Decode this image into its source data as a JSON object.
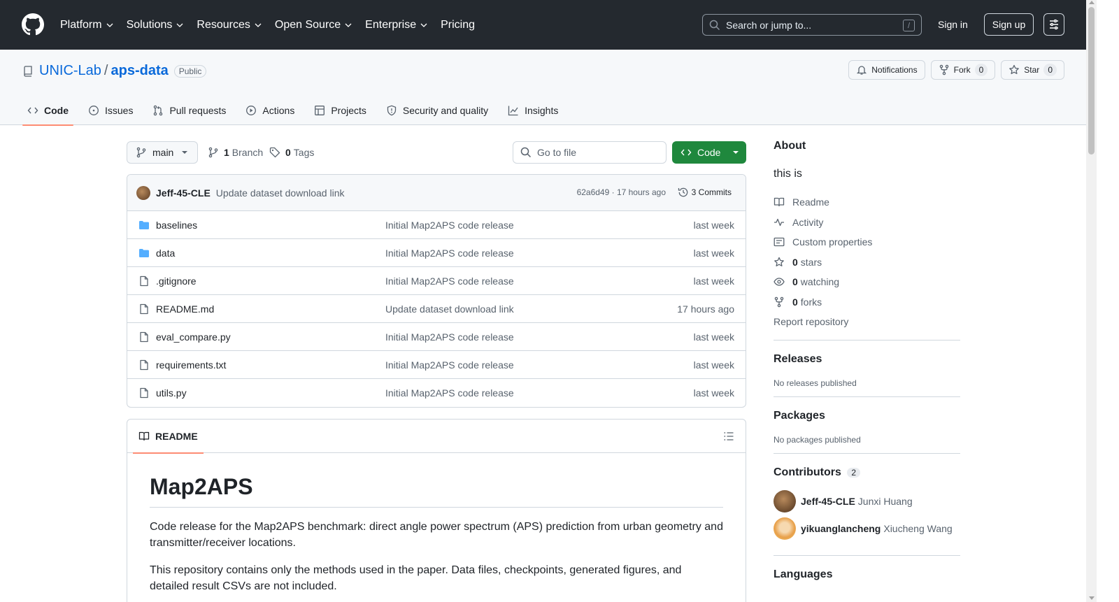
{
  "colors": {
    "header_bg": "#24292f",
    "link": "#0969da",
    "primary_button": "#1f883d",
    "tab_underline": "#fd8c73",
    "muted_text": "#59636e",
    "border": "#d0d7de"
  },
  "header": {
    "nav": [
      {
        "label": "Platform",
        "dropdown": true
      },
      {
        "label": "Solutions",
        "dropdown": true
      },
      {
        "label": "Resources",
        "dropdown": true
      },
      {
        "label": "Open Source",
        "dropdown": true
      },
      {
        "label": "Enterprise",
        "dropdown": true
      },
      {
        "label": "Pricing",
        "dropdown": false
      }
    ],
    "search_placeholder": "Search or jump to...",
    "search_shortcut": "/",
    "signin": "Sign in",
    "signup": "Sign up"
  },
  "repo": {
    "owner": "UNIC-Lab",
    "separator": "/",
    "name": "aps-data",
    "visibility": "Public",
    "notifications_label": "Notifications",
    "fork_label": "Fork",
    "fork_count": "0",
    "star_label": "Star",
    "star_count": "0",
    "tabs": [
      {
        "label": "Code",
        "icon": "code-icon",
        "active": true
      },
      {
        "label": "Issues",
        "icon": "issue-icon",
        "active": false
      },
      {
        "label": "Pull requests",
        "icon": "pull-request-icon",
        "active": false
      },
      {
        "label": "Actions",
        "icon": "play-icon",
        "active": false
      },
      {
        "label": "Projects",
        "icon": "table-icon",
        "active": false
      },
      {
        "label": "Security and quality",
        "icon": "shield-icon",
        "active": false
      },
      {
        "label": "Insights",
        "icon": "graph-icon",
        "active": false
      }
    ]
  },
  "toolbar": {
    "branch": "main",
    "branch_count": "1",
    "branch_label": "Branch",
    "tag_count": "0",
    "tag_label": "Tags",
    "goto_file_placeholder": "Go to file",
    "code_button": "Code"
  },
  "commit": {
    "author": "Jeff-45-CLE",
    "message": "Update dataset download link",
    "meta": "62a6d49 · 17 hours ago",
    "count_label": "3 Commits"
  },
  "files": [
    {
      "name": "baselines",
      "type": "folder",
      "message": "Initial Map2APS code release",
      "date": "last week"
    },
    {
      "name": "data",
      "type": "folder",
      "message": "Initial Map2APS code release",
      "date": "last week"
    },
    {
      "name": ".gitignore",
      "type": "file",
      "message": "Initial Map2APS code release",
      "date": "last week"
    },
    {
      "name": "README.md",
      "type": "file",
      "message": "Update dataset download link",
      "date": "17 hours ago"
    },
    {
      "name": "eval_compare.py",
      "type": "file",
      "message": "Initial Map2APS code release",
      "date": "last week"
    },
    {
      "name": "requirements.txt",
      "type": "file",
      "message": "Initial Map2APS code release",
      "date": "last week"
    },
    {
      "name": "utils.py",
      "type": "file",
      "message": "Initial Map2APS code release",
      "date": "last week"
    }
  ],
  "readme": {
    "tab_label": "README",
    "title": "Map2APS",
    "paragraphs": [
      "Code release for the Map2APS benchmark: direct angle power spectrum (APS) prediction from urban geometry and transmitter/receiver locations.",
      "This repository contains only the methods used in the paper. Data files, checkpoints, generated figures, and detailed result CSVs are not included."
    ]
  },
  "sidebar": {
    "about_title": "About",
    "description": "this is",
    "links": [
      {
        "icon": "book-icon",
        "count": "",
        "label": "Readme"
      },
      {
        "icon": "pulse-icon",
        "count": "",
        "label": "Activity"
      },
      {
        "icon": "note-icon",
        "count": "",
        "label": "Custom properties"
      },
      {
        "icon": "star-icon",
        "count": "0",
        "label": "stars"
      },
      {
        "icon": "eye-icon",
        "count": "0",
        "label": "watching"
      },
      {
        "icon": "fork-icon",
        "count": "0",
        "label": "forks"
      }
    ],
    "report": "Report repository",
    "releases_title": "Releases",
    "releases_note": "No releases published",
    "packages_title": "Packages",
    "packages_note": "No packages published",
    "contributors_title": "Contributors",
    "contributors_count": "2",
    "contributors": [
      {
        "login": "Jeff-45-CLE",
        "name": "Junxi Huang"
      },
      {
        "login": "yikuanglancheng",
        "name": "Xiucheng Wang"
      }
    ],
    "languages_title": "Languages"
  }
}
